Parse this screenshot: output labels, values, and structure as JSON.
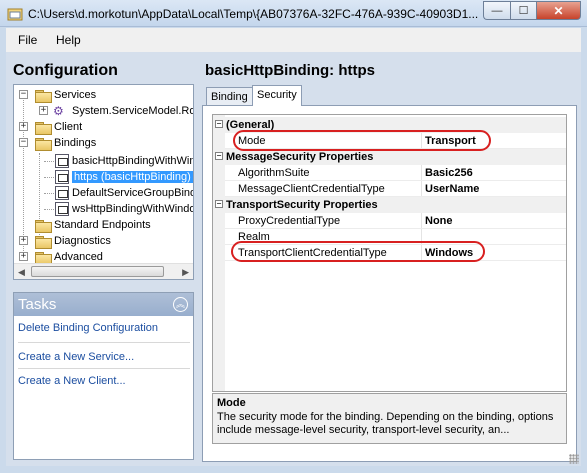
{
  "window": {
    "title": "C:\\Users\\d.morkotun\\AppData\\Local\\Temp\\{AB07376A-32FC-476A-939C-40903D1...",
    "min_glyph": "—",
    "max_glyph": "☐",
    "close_glyph": "✕"
  },
  "menu": {
    "file": "File",
    "help": "Help"
  },
  "configuration": {
    "header": "Configuration",
    "tree": [
      {
        "label": "Services",
        "icon": "folder-icon",
        "expander": "−"
      },
      {
        "label": "System.ServiceModel.Routing.RoutingService",
        "icon": "service-gear-icon",
        "expander": "+"
      },
      {
        "label": "Client",
        "icon": "folder-icon",
        "expander": "+"
      },
      {
        "label": "Bindings",
        "icon": "folder-icon",
        "expander": "−"
      },
      {
        "label": "basicHttpBindingWithWindowsAuth",
        "icon": "binding-icon"
      },
      {
        "label": "https (basicHttpBinding)",
        "icon": "binding-icon",
        "selected": true
      },
      {
        "label": "DefaultServiceGroupBinding",
        "icon": "binding-icon"
      },
      {
        "label": "wsHttpBindingWithWindowsAuth",
        "icon": "binding-icon"
      },
      {
        "label": "Standard Endpoints",
        "icon": "folder-icon"
      },
      {
        "label": "Diagnostics",
        "icon": "folder-icon",
        "expander": "+"
      },
      {
        "label": "Advanced",
        "icon": "folder-icon",
        "expander": "+"
      }
    ]
  },
  "tasks": {
    "title": "Tasks",
    "toggle_glyph": "︽",
    "links": [
      "Delete Binding Configuration",
      "Create a New Service...",
      "Create a New Client..."
    ]
  },
  "binding": {
    "header": "basicHttpBinding: https",
    "tabs": [
      "Binding",
      "Security"
    ],
    "active_tab": "Security"
  },
  "property_grid": {
    "categories": [
      {
        "name": "(General)",
        "expander": "−",
        "props": [
          {
            "name": "Mode",
            "value": "Transport",
            "highlighted": true
          }
        ]
      },
      {
        "name": "MessageSecurity Properties",
        "expander": "−",
        "props": [
          {
            "name": "AlgorithmSuite",
            "value": "Basic256"
          },
          {
            "name": "MessageClientCredentialType",
            "value": "UserName"
          }
        ]
      },
      {
        "name": "TransportSecurity Properties",
        "expander": "−",
        "props": [
          {
            "name": "ProxyCredentialType",
            "value": "None"
          },
          {
            "name": "Realm",
            "value": ""
          },
          {
            "name": "TransportClientCredentialType",
            "value": "Windows",
            "highlighted": true
          }
        ]
      }
    ]
  },
  "description": {
    "title": "Mode",
    "text": "The security mode for the binding. Depending on the binding, options include message-level security, transport-level security, an..."
  },
  "colors": {
    "highlight_oval": "#d82020",
    "link": "#1c4ea0",
    "selection": "#3399ff"
  }
}
